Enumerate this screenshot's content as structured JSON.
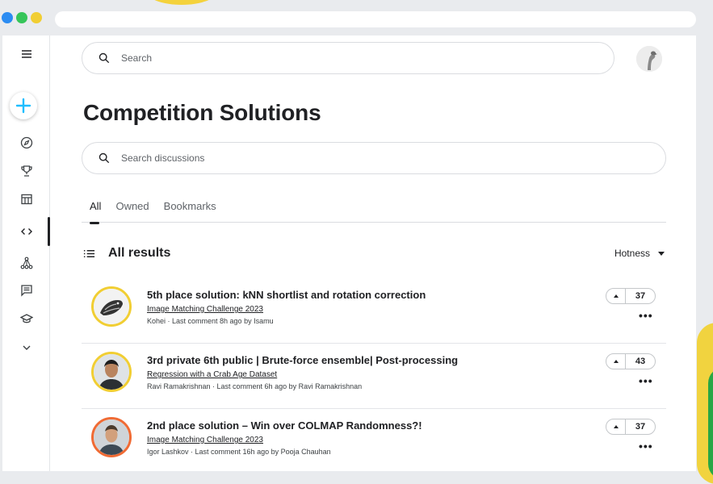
{
  "window": {
    "dot_colors": [
      "#2b8cf2",
      "#36c55a",
      "#f1ce33"
    ]
  },
  "sidebar": {
    "items": [
      {
        "icon": "menu-icon"
      },
      {
        "icon": "plus-icon"
      },
      {
        "icon": "compass-icon"
      },
      {
        "icon": "trophy-icon"
      },
      {
        "icon": "table-icon"
      },
      {
        "icon": "code-icon"
      },
      {
        "icon": "models-icon"
      },
      {
        "icon": "discussion-icon"
      },
      {
        "icon": "learn-icon"
      },
      {
        "icon": "chevron-down-icon"
      }
    ]
  },
  "header": {
    "search_placeholder": "Search"
  },
  "page": {
    "title": "Competition Solutions",
    "discussion_search_placeholder": "Search discussions",
    "tabs": [
      "All",
      "Owned",
      "Bookmarks"
    ],
    "results_title": "All results",
    "sort_label": "Hotness"
  },
  "results": [
    {
      "title": "5th place solution: kNN shortlist and rotation correction",
      "competition": "Image Matching Challenge 2023",
      "meta": "Kohei · Last comment 8h ago by Isamu",
      "votes": "37"
    },
    {
      "title": "3rd private 6th public | Brute-force ensemble| Post-processing",
      "competition": "Regression with a Crab Age Dataset",
      "meta": "Ravi Ramakrishnan · Last comment 6h ago by Ravi Ramakrishnan",
      "votes": "43"
    },
    {
      "title": "2nd place solution – Win over COLMAP Randomness?!",
      "competition": "Image Matching Challenge 2023",
      "meta": "Igor Lashkov · Last comment 16h ago by Pooja Chauhan",
      "votes": "37"
    }
  ],
  "colors": {
    "accent": "#20beff",
    "tier_gold": "#f1ce33",
    "tier_grandmaster": "#f06b34"
  }
}
